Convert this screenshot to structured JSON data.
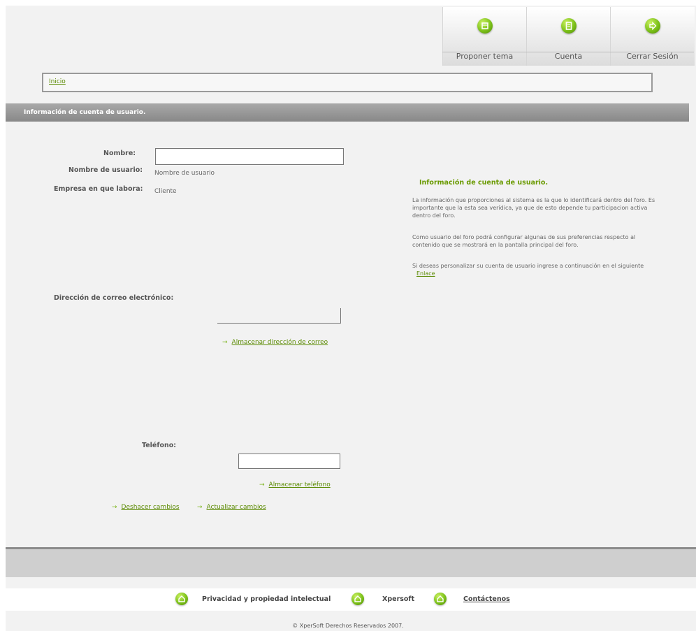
{
  "nav": {
    "items": [
      {
        "label": "Proponer tema",
        "icon": "document-icon"
      },
      {
        "label": "Cuenta",
        "icon": "account-icon"
      },
      {
        "label": "Cerrar Sesión",
        "icon": "logout-arrow-icon"
      }
    ]
  },
  "breadcrumb": {
    "home": "Inicio"
  },
  "section": {
    "title": "Información de cuenta de usuario."
  },
  "form": {
    "name_label": "Nombre:",
    "name_value": "",
    "username_label": "Nombre de usuario:",
    "username_value": "Nombre de usuario",
    "company_label": "Empresa en que labora:",
    "company_value": "Cliente",
    "email_label": "Dirección de correo electrónico:",
    "email_value": "",
    "save_email": "Almacenar dirección de correo",
    "phone_label": "Teléfono:",
    "phone_value": "",
    "save_phone": "Almacenar teléfono",
    "undo": "Deshacer cambios",
    "update": "Actualizar cambios"
  },
  "info": {
    "title": "Información de cuenta de usuario.",
    "p1": "La información que proporciones al sistema es la que lo identificará dentro del foro. Es importante que la esta sea verídica, ya que de esto depende tu participacion activa dentro del foro.",
    "p2": "Como usuario del foro podrá configurar algunas de sus preferencias respecto al contenido que se mostrará en la pantalla principal del foro.",
    "p3_text": "Si deseas personalizar su cuenta de usuario ingrese a continuación en el siguiente",
    "p3_link": "Enlace"
  },
  "footer": {
    "privacy": "Privacidad y propiedad intelectual",
    "company": "Xpersoft",
    "contact": "Contáctenos",
    "copyright": "© XperSoft Derechos Reservados 2007."
  },
  "colors": {
    "accent": "#7cc11a",
    "link": "#5a8a00",
    "header_bar": "#999999",
    "background": "#f2f2f2"
  }
}
